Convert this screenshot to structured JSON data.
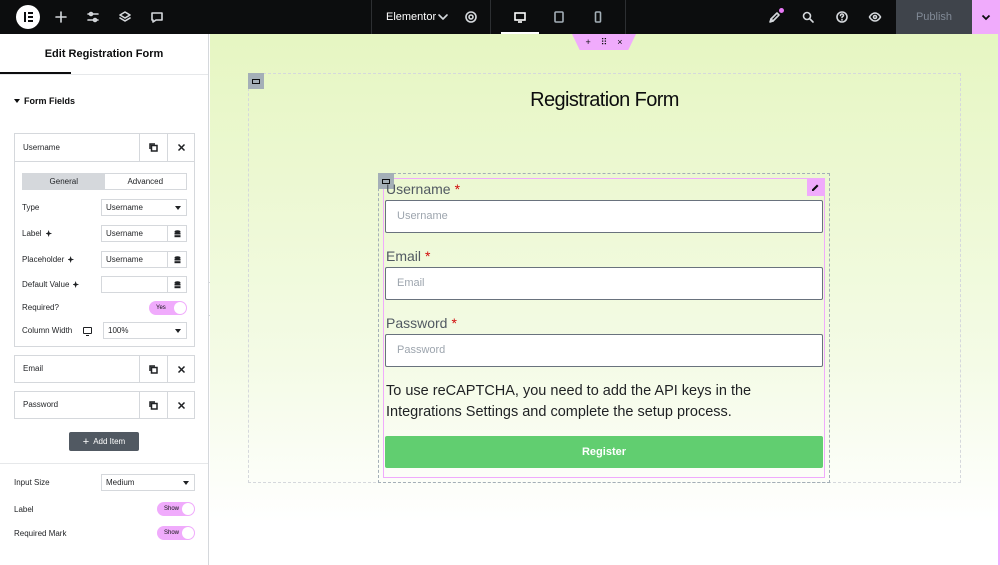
{
  "topbar": {
    "site_name": "Elementor",
    "publish_label": "Publish",
    "icons": [
      "elementor-logo-icon",
      "add-icon",
      "sliders-icon",
      "layers-icon",
      "comments-icon",
      "settings-icon",
      "desktop-icon",
      "tablet-icon",
      "mobile-icon",
      "notifications-icon",
      "search-icon",
      "help-icon",
      "preview-icon",
      "chevron-down-icon"
    ]
  },
  "panel": {
    "title": "Edit Registration Form",
    "section_title": "Form Fields",
    "fields": [
      {
        "label": "Username"
      },
      {
        "label": "Email"
      },
      {
        "label": "Password"
      }
    ],
    "tabs": {
      "general": "General",
      "advanced": "Advanced"
    },
    "controls": {
      "type_label": "Type",
      "type_value": "Username",
      "label_label": "Label",
      "label_value": "Username",
      "placeholder_label": "Placeholder",
      "placeholder_value": "Username",
      "default_label": "Default Value",
      "default_value": "",
      "required_label": "Required?",
      "required_value": "Yes",
      "width_label": "Column Width",
      "width_value": "100%"
    },
    "add_item": "Add Item",
    "style": {
      "input_size_label": "Input Size",
      "input_size_value": "Medium",
      "label_label": "Label",
      "label_value": "Show",
      "required_mark_label": "Required Mark",
      "required_mark_value": "Show"
    }
  },
  "canvas": {
    "title": "Registration Form",
    "fields": [
      {
        "label": "Username",
        "placeholder": "Username",
        "required_mark": "*"
      },
      {
        "label": "Email",
        "placeholder": "Email",
        "required_mark": "*"
      },
      {
        "label": "Password",
        "placeholder": "Password",
        "required_mark": "*"
      }
    ],
    "recaptcha_notice": "To use reCAPTCHA, you need to add the API keys in the Integrations Settings and complete the setup process.",
    "submit_label": "Register",
    "section_handle": {
      "add": "+",
      "move": "⠿",
      "close": "×"
    }
  },
  "colors": {
    "accent": "#f0abfc",
    "submit": "#61ce70",
    "required": "#d10a0a",
    "topbar": "#0c0d0e"
  }
}
